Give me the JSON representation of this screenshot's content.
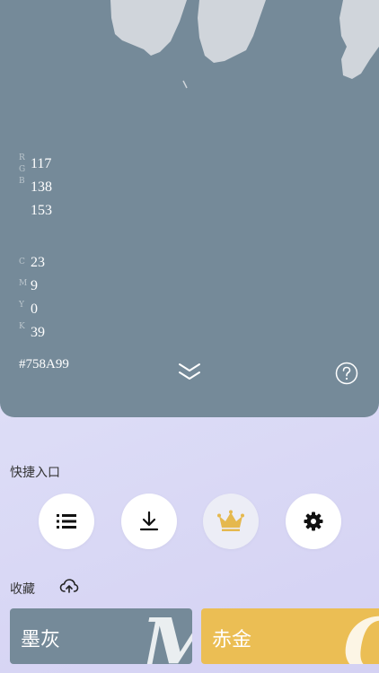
{
  "current_color": {
    "bg": "#758A99",
    "rgb": {
      "labels": [
        "R",
        "G",
        "B"
      ],
      "values": [
        "117",
        "138",
        "153"
      ]
    },
    "cmyk": {
      "labels": [
        "C",
        "M",
        "Y",
        "K"
      ],
      "values": [
        "23",
        "9",
        "0",
        "39"
      ]
    },
    "hex": "#758A99"
  },
  "quick_entry": {
    "title": "快捷入口",
    "buttons": [
      {
        "icon": "list-icon"
      },
      {
        "icon": "download-icon"
      },
      {
        "icon": "crown-icon",
        "color": "#e5b84e"
      },
      {
        "icon": "gear-icon"
      }
    ]
  },
  "favorites": {
    "title": "收藏",
    "sync_icon": "cloud-sync-icon",
    "items": [
      {
        "name": "墨灰",
        "color": "#758A99",
        "letter": "M"
      },
      {
        "name": "赤金",
        "color": "#EBBE54",
        "letter": "C"
      }
    ]
  }
}
